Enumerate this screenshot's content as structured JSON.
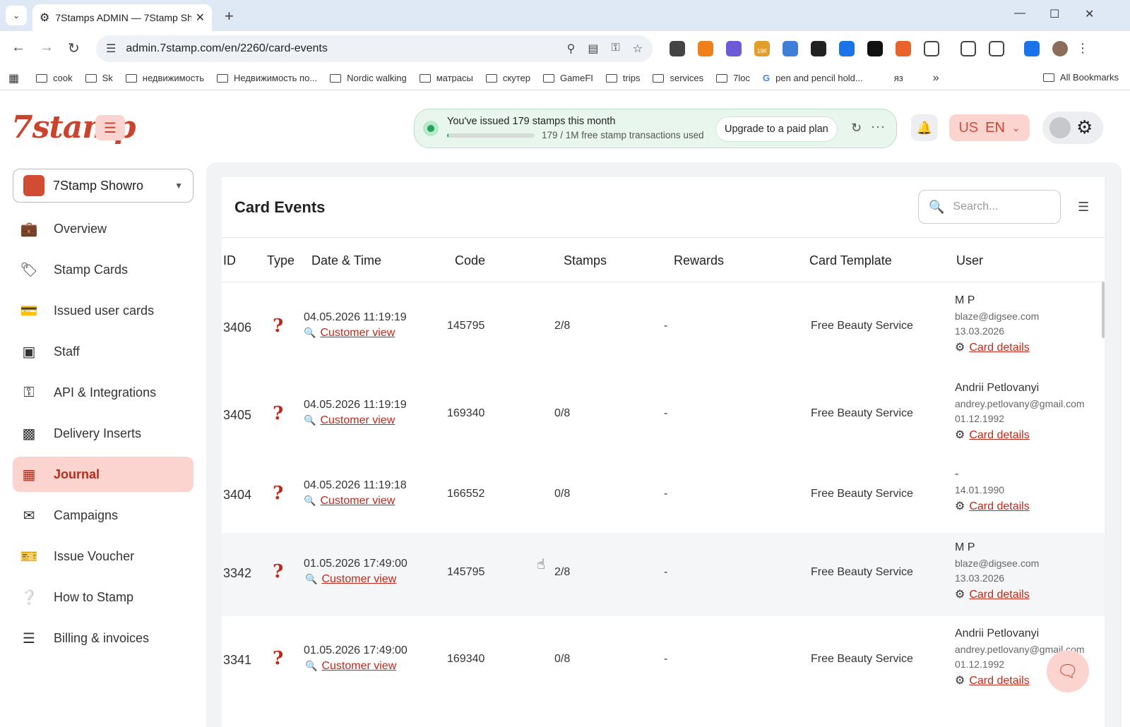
{
  "browser": {
    "tab_title": "7Stamps ADMIN — 7Stamp Sh",
    "url": "admin.7stamp.com/en/2260/card-events",
    "extension_badge": "19K",
    "bookmarks": [
      "cook",
      "Sk",
      "недвижимость",
      "Недвижимость по...",
      "Nordic walking",
      "матрасы",
      "скутер",
      "GameFI",
      "trips",
      "services",
      "7loc",
      "pen and pencil hold...",
      "яз"
    ],
    "all_bookmarks": "All Bookmarks"
  },
  "header": {
    "logo": "7stamp",
    "usage_title": "You've issued 179 stamps this month",
    "usage_sub": "179 / 1M free stamp transactions used",
    "usage_fraction": 0.00018,
    "upgrade_label": "Upgrade to a paid plan",
    "lang_flag": "US",
    "lang_code": "EN"
  },
  "sidebar": {
    "shop_name": "7Stamp Showro",
    "items": [
      {
        "label": "Overview",
        "icon": "briefcase-icon"
      },
      {
        "label": "Stamp Cards",
        "icon": "tag-icon"
      },
      {
        "label": "Issued user cards",
        "icon": "id-card-icon"
      },
      {
        "label": "Staff",
        "icon": "staff-scan-icon"
      },
      {
        "label": "API & Integrations",
        "icon": "key-icon"
      },
      {
        "label": "Delivery Inserts",
        "icon": "cards-icon"
      },
      {
        "label": "Journal",
        "icon": "table-icon",
        "active": true
      },
      {
        "label": "Campaigns",
        "icon": "mail-icon"
      },
      {
        "label": "Issue Voucher",
        "icon": "ticket-icon"
      },
      {
        "label": "How to Stamp",
        "icon": "question-icon"
      },
      {
        "label": "Billing & invoices",
        "icon": "list-icon"
      }
    ]
  },
  "main": {
    "title": "Card Events",
    "search_placeholder": "Search...",
    "columns": [
      "ID",
      "Type",
      "Date & Time",
      "Code",
      "Stamps",
      "Rewards",
      "Card Template",
      "User"
    ],
    "customer_view_label": "Customer view",
    "card_details_label": "Card details",
    "rows": [
      {
        "id": "3406",
        "datetime": "04.05.2026 11:19:19",
        "code": "145795",
        "stamps": "2/8",
        "rewards": "-",
        "template": "Free Beauty Service",
        "user_name": "M P",
        "user_email": "blaze@digsee.com",
        "user_date": "13.03.2026"
      },
      {
        "id": "3405",
        "datetime": "04.05.2026 11:19:19",
        "code": "169340",
        "stamps": "0/8",
        "rewards": "-",
        "template": "Free Beauty Service",
        "user_name": "Andrii Petlovanyi",
        "user_email": "andrey.petlovany@gmail.com",
        "user_date": "01.12.1992"
      },
      {
        "id": "3404",
        "datetime": "04.05.2026 11:19:18",
        "code": "166552",
        "stamps": "0/8",
        "rewards": "-",
        "template": "Free Beauty Service",
        "user_name": "-",
        "user_email": "",
        "user_date": "14.01.1990"
      },
      {
        "id": "3342",
        "datetime": "01.05.2026 17:49:00",
        "code": "145795",
        "stamps": "2/8",
        "rewards": "-",
        "template": "Free Beauty Service",
        "user_name": "M P",
        "user_email": "blaze@digsee.com",
        "user_date": "13.03.2026"
      },
      {
        "id": "3341",
        "datetime": "01.05.2026 17:49:00",
        "code": "169340",
        "stamps": "0/8",
        "rewards": "-",
        "template": "Free Beauty Service",
        "user_name": "Andrii Petlovanyi",
        "user_email": "andrey.petlovany@gmail.com",
        "user_date": "01.12.1992"
      }
    ]
  }
}
